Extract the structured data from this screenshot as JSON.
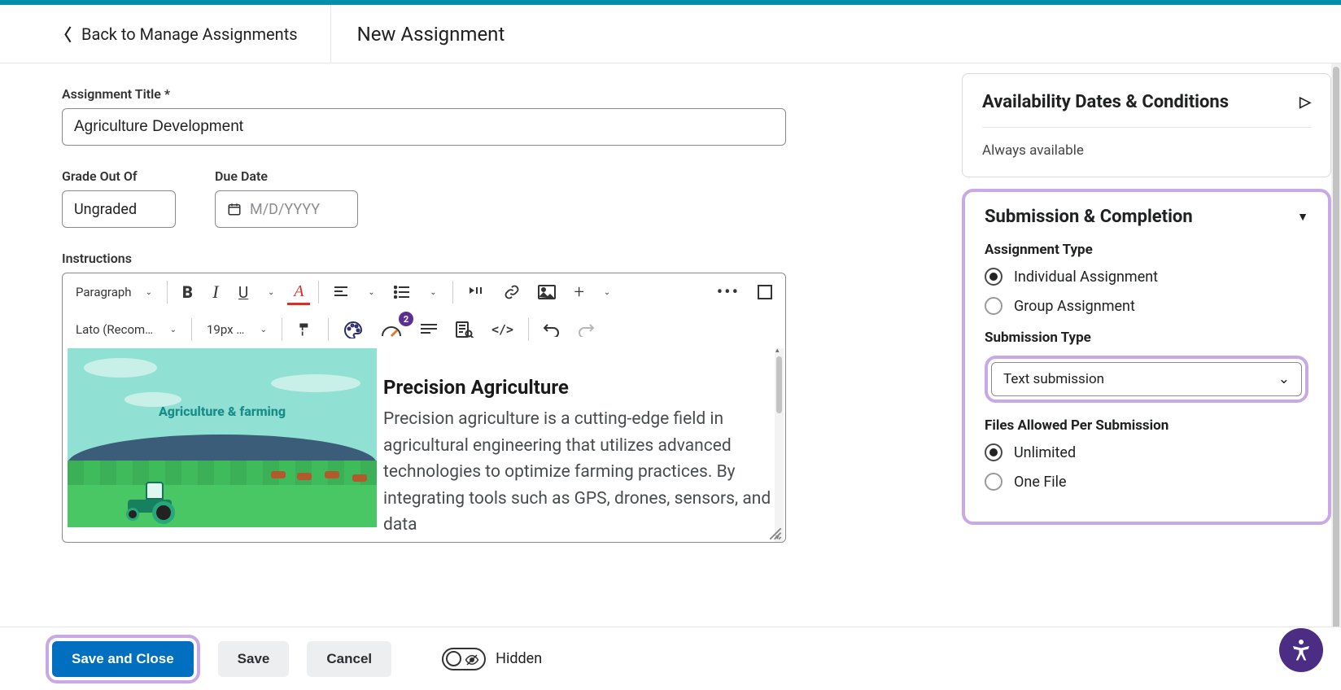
{
  "header": {
    "back_label": "Back to Manage Assignments",
    "page_title": "New Assignment"
  },
  "form": {
    "title_label": "Assignment Title *",
    "title_value": "Agriculture Development",
    "grade_label": "Grade Out Of",
    "grade_value": "Ungraded",
    "due_label": "Due Date",
    "due_placeholder": "M/D/YYYY",
    "instructions_label": "Instructions"
  },
  "editor": {
    "format_dropdown": "Paragraph",
    "font_dropdown": "Lato (Recom…",
    "size_dropdown": "19px …",
    "a11y_badge": "2",
    "content_heading": "Precision Agriculture",
    "content_body": "Precision agriculture is a cutting-edge field in agricultural engineering that utilizes advanced technologies to optimize farming practices. By integrating tools such as GPS, drones, sensors, and data",
    "illustration_caption": "Agriculture & farming"
  },
  "sidebar": {
    "availability": {
      "title": "Availability Dates & Conditions",
      "status": "Always available"
    },
    "submission": {
      "title": "Submission & Completion",
      "assignment_type_label": "Assignment Type",
      "assignment_type_options": {
        "individual": "Individual Assignment",
        "group": "Group Assignment"
      },
      "submission_type_label": "Submission Type",
      "submission_type_value": "Text submission",
      "files_label": "Files Allowed Per Submission",
      "files_options": {
        "unlimited": "Unlimited",
        "one": "One File"
      }
    }
  },
  "footer": {
    "save_close": "Save and Close",
    "save": "Save",
    "cancel": "Cancel",
    "visibility": "Hidden"
  }
}
